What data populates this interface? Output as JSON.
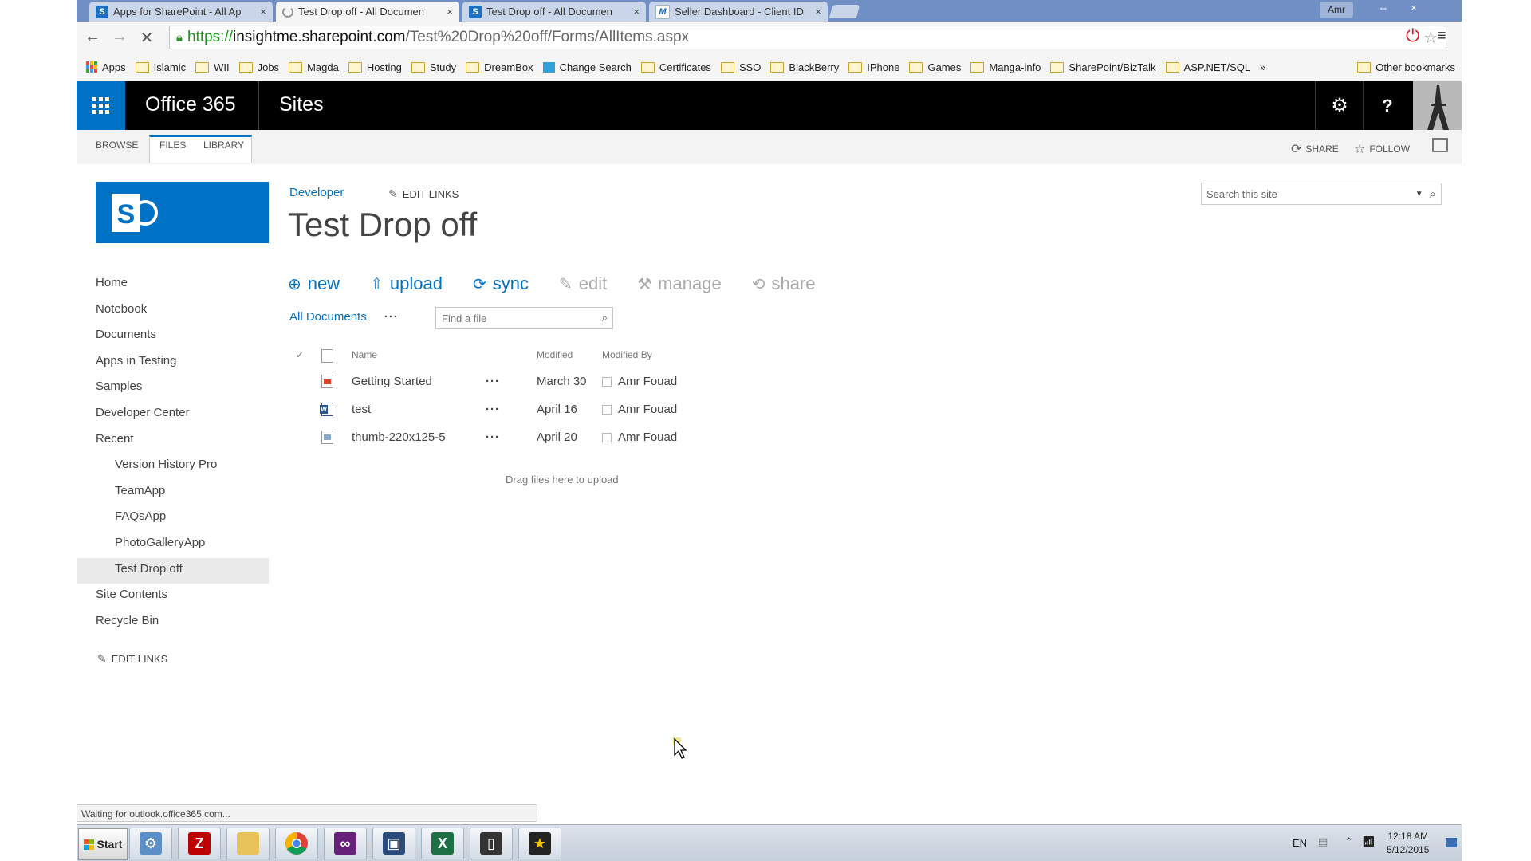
{
  "browser": {
    "tabs": [
      {
        "title": "Apps for SharePoint - All Ap",
        "icon": "sharepoint-favicon",
        "active": false
      },
      {
        "title": "Test Drop off - All Documen",
        "icon": "loading-spinner",
        "active": true
      },
      {
        "title": "Test Drop off - All Documen",
        "icon": "sharepoint-favicon",
        "active": false
      },
      {
        "title": "Seller Dashboard - Client ID",
        "icon": "m-favicon",
        "active": false
      }
    ],
    "tab_close": "×",
    "profile": "Amr",
    "window_buttons": {
      "restore": "⇔",
      "close": "×"
    },
    "url": {
      "scheme": "https://",
      "host": "insightme.sharepoint.com",
      "path": "/Test%20Drop%20off/Forms/AllItems.aspx"
    },
    "bookmarks": [
      "Apps",
      "Islamic",
      "WII",
      "Jobs",
      "Magda",
      "Hosting",
      "Study",
      "DreamBox",
      "Change Search",
      "Certificates",
      "SSO",
      "BlackBerry",
      "IPhone",
      "Games",
      "Manga-info",
      "SharePoint/BizTalk",
      "ASP.NET/SQL"
    ],
    "bookmarks_overflow": "»",
    "other_bookmarks": "Other bookmarks",
    "status": "Waiting for outlook.office365.com..."
  },
  "suite": {
    "brand": "Office 365",
    "section": "Sites",
    "help": "?"
  },
  "ribbon": {
    "tabs": [
      "BROWSE",
      "FILES",
      "LIBRARY"
    ],
    "share": "SHARE",
    "follow": "FOLLOW"
  },
  "site": {
    "breadcrumb": "Developer",
    "edit_links": "EDIT LINKS",
    "title": "Test Drop off",
    "search_placeholder": "Search this site"
  },
  "leftnav": {
    "items": [
      {
        "label": "Home",
        "level": 0
      },
      {
        "label": "Notebook",
        "level": 0
      },
      {
        "label": "Documents",
        "level": 0
      },
      {
        "label": "Apps in Testing",
        "level": 0
      },
      {
        "label": "Samples",
        "level": 0
      },
      {
        "label": "Developer Center",
        "level": 0
      },
      {
        "label": "Recent",
        "level": 0
      },
      {
        "label": "Version History Pro",
        "level": 1
      },
      {
        "label": "TeamApp",
        "level": 1
      },
      {
        "label": "FAQsApp",
        "level": 1
      },
      {
        "label": "PhotoGalleryApp",
        "level": 1
      },
      {
        "label": "Test Drop off",
        "level": 1,
        "selected": true
      },
      {
        "label": "Site Contents",
        "level": 0
      },
      {
        "label": "Recycle Bin",
        "level": 0
      }
    ],
    "edit_links": "EDIT LINKS"
  },
  "commands": [
    {
      "label": "new",
      "icon": "plus-circle-icon",
      "enabled": true
    },
    {
      "label": "upload",
      "icon": "upload-arrow-icon",
      "enabled": true
    },
    {
      "label": "sync",
      "icon": "sync-icon",
      "enabled": true
    },
    {
      "label": "edit",
      "icon": "pencil-icon",
      "enabled": false
    },
    {
      "label": "manage",
      "icon": "wrench-icon",
      "enabled": false
    },
    {
      "label": "share",
      "icon": "share-icon",
      "enabled": false
    }
  ],
  "view": {
    "current": "All Documents",
    "more": "···",
    "find_placeholder": "Find a file"
  },
  "list": {
    "columns": {
      "name": "Name",
      "modified": "Modified",
      "modified_by": "Modified By"
    },
    "rows": [
      {
        "name": "Getting Started",
        "type": "pdf",
        "modified": "March 30",
        "modified_by": "Amr Fouad"
      },
      {
        "name": "test",
        "type": "word",
        "modified": "April 16",
        "modified_by": "Amr Fouad"
      },
      {
        "name": "thumb-220x125-5",
        "type": "image",
        "modified": "April 20",
        "modified_by": "Amr Fouad"
      }
    ],
    "row_menu": "···",
    "drag_message": "Drag files here to upload"
  },
  "taskbar": {
    "start": "Start",
    "apps": [
      "control-panel",
      "filezilla",
      "file-explorer",
      "chrome",
      "visual-studio",
      "media-app",
      "excel",
      "phone-app",
      "imovie-app"
    ],
    "language": "EN",
    "time": "12:18 AM",
    "date": "5/12/2015"
  },
  "colors": {
    "accent": "#0072c6",
    "suite_bg": "#000000",
    "tab_strip": "#6f8fc5"
  }
}
